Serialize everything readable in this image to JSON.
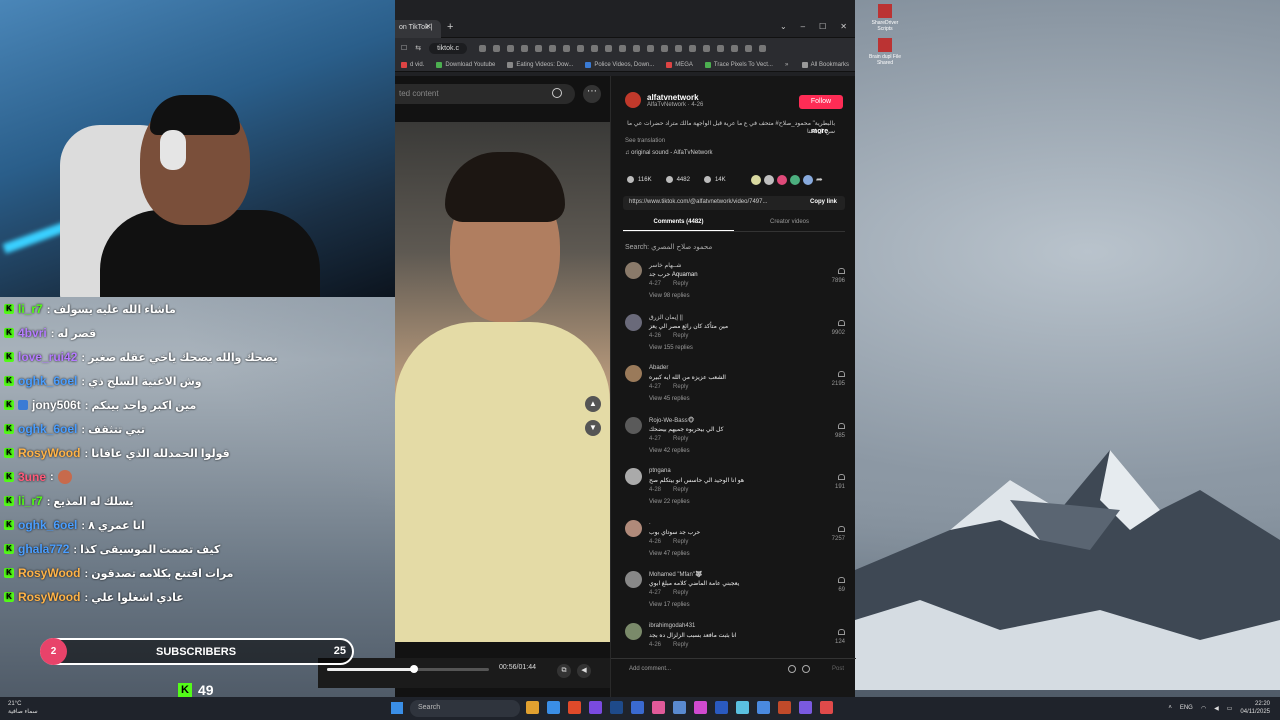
{
  "browser": {
    "tab_title": "on TikTok |",
    "url": "tiktok.c",
    "bookmarks": [
      {
        "label": "d vid."
      },
      {
        "label": "Download Youtube"
      },
      {
        "label": "Eating Videos: Dow..."
      },
      {
        "label": "Police Videos, Down..."
      },
      {
        "label": "MEGA"
      },
      {
        "label": "Trace Pixels To Vect..."
      }
    ],
    "bookmarks_overflow": "»",
    "all_bookmarks": "All Bookmarks"
  },
  "tiktok": {
    "search_placeholder": "ted content",
    "author": {
      "handle": "alfatvnetwork",
      "sub": "AlfaTvNetwork · 4-26"
    },
    "follow_label": "Follow",
    "description": "بالبطرية\" محمود_صلاح# متحف في ع ما عرية قبل الواجهة مالك متراد حضرات عي ما سن ال احنا",
    "more": "more",
    "see_translation": "See translation",
    "sound": "♫ original sound - AlfaTvNetwork",
    "stats": {
      "likes": "116K",
      "comments": "4482",
      "saves": "14K"
    },
    "share_colors": [
      "#d9d9a0",
      "#bfbfbf",
      "#e04a7a",
      "#4caf7f",
      "#8ad"
    ],
    "share_more": "➦",
    "link": "https://www.tiktok.com/@alfatvnetwork/video/7497...",
    "copy_link": "Copy link",
    "tab_comments": "Comments (4482)",
    "tab_creator": "Creator videos",
    "search_line": "Search: محمود صلاح المصري",
    "comments": [
      {
        "user": "شــهام خاسر",
        "text": "Aquaman حرب جد",
        "date": "4-27",
        "reply": "Reply",
        "views": "View 98 replies",
        "likes": "7896",
        "color": "#8a7a6a"
      },
      {
        "user": "إيمان الزرق ||",
        "text": "مين متأكد كان رائع مصر الي يعز",
        "date": "4-26",
        "reply": "Reply",
        "views": "View 155 replies",
        "likes": "9902",
        "color": "#6a6a7a"
      },
      {
        "user": "Abader",
        "text": "الشعب عزيزه من الله ايه كبيره",
        "date": "4-27",
        "reply": "Reply",
        "views": "View 45 replies",
        "likes": "2195",
        "color": "#9a7a5a"
      },
      {
        "user": "Rojo-We-Bass🐵",
        "text": "كل الي بيحربوه جميهم بيضحك",
        "date": "4-27",
        "reply": "Reply",
        "views": "View 42 replies",
        "likes": "985",
        "color": "#5a5a5a"
      },
      {
        "user": "ptngana",
        "text": "هو انا الوحيد الي حاسس انو بيتكلم صح",
        "date": "4-28",
        "reply": "Reply",
        "views": "View 22 replies",
        "likes": "191",
        "color": "#aaa"
      },
      {
        "user": ".",
        "text": "حرب جد سوتاي بوب",
        "date": "4-26",
        "reply": "Reply",
        "views": "View 47 replies",
        "likes": "7257",
        "color": "#b08a7a"
      },
      {
        "user": "Mohamed \"Mfan\"🐺",
        "text": "يعجبني عامة الماضي كلامه مبلغ ابوي",
        "date": "4-27",
        "reply": "Reply",
        "views": "View 17 replies",
        "likes": "69",
        "color": "#888"
      },
      {
        "user": "ibrahimgodah431",
        "text": "انا بثبت مافعد بسبب الزلزال ده بجد",
        "date": "4-26",
        "reply": "Reply",
        "views": "",
        "likes": "124",
        "color": "#7a8a6a"
      }
    ],
    "add_comment": "Add comment...",
    "post": "Post",
    "time": "00:56/01:44",
    "progress": 0.54
  },
  "chat": [
    {
      "user": "li_r7",
      "color": "#53fc18",
      "msg": ": ماشاء الله عليه يسولف"
    },
    {
      "user": "4bvri",
      "color": "#b57cff",
      "msg": ": قصر له"
    },
    {
      "user": "love_rui42",
      "color": "#b57cff",
      "msg": ": يضحك والله يضحك ياخي عقله صغير"
    },
    {
      "user": "oghk_6oel",
      "color": "#4a9eff",
      "msg": ": وش الاغنية السلح ذي"
    },
    {
      "user": "jony506t",
      "color": "#ffffff",
      "msg": ": مين اكبر واحد بينكم",
      "extra": true
    },
    {
      "user": "oghk_6oel",
      "color": "#4a9eff",
      "msg": ": تبي تتثقف"
    },
    {
      "user": "RosyWood",
      "color": "#ffb347",
      "msg": ": قولوا الحمدلله الذي عافانا"
    },
    {
      "user": "3une",
      "color": "#ff5a7a",
      "msg": ":",
      "emoji": true
    },
    {
      "user": "li_r7",
      "color": "#53fc18",
      "msg": ": يسلك له المذيع"
    },
    {
      "user": "oghk_6oel",
      "color": "#4a9eff",
      "msg": ": انا عمري ٨"
    },
    {
      "user": "ghala772",
      "color": "#4a9eff",
      "msg": ": كيف تصمت الموسيقى كذا"
    },
    {
      "user": "RosyWood",
      "color": "#ffb347",
      "msg": ": مرات اقتنع بكلامه تصدقون"
    },
    {
      "user": "RosyWood",
      "color": "#ffb347",
      "msg": ": عادي اشغلوا علي"
    }
  ],
  "subs": {
    "badge": "2",
    "label": "SUBSCRIBERS",
    "count": "25"
  },
  "kick": {
    "logo": "K",
    "count": "49"
  },
  "taskbar": {
    "weather_temp": "21°C",
    "weather_desc": "سماء صافية",
    "search": "Search",
    "lang": "ENG",
    "time": "22:20",
    "date": "04/11/2025",
    "app_colors": [
      "#e0a030",
      "#3a8ee6",
      "#e04a2a",
      "#7a4ae0",
      "#1e4a8a",
      "#3a6ad0",
      "#e05a9a",
      "#5a8ad0",
      "#d04ad0",
      "#2a5ac0",
      "#5ac0e0",
      "#4a8ae0",
      "#c04a2a",
      "#7a5ae0",
      "#e04a4a"
    ]
  },
  "desktop_icons": [
    {
      "label": "ShareDriver Scripts"
    },
    {
      "label": "Brain dupl File Shared"
    }
  ]
}
